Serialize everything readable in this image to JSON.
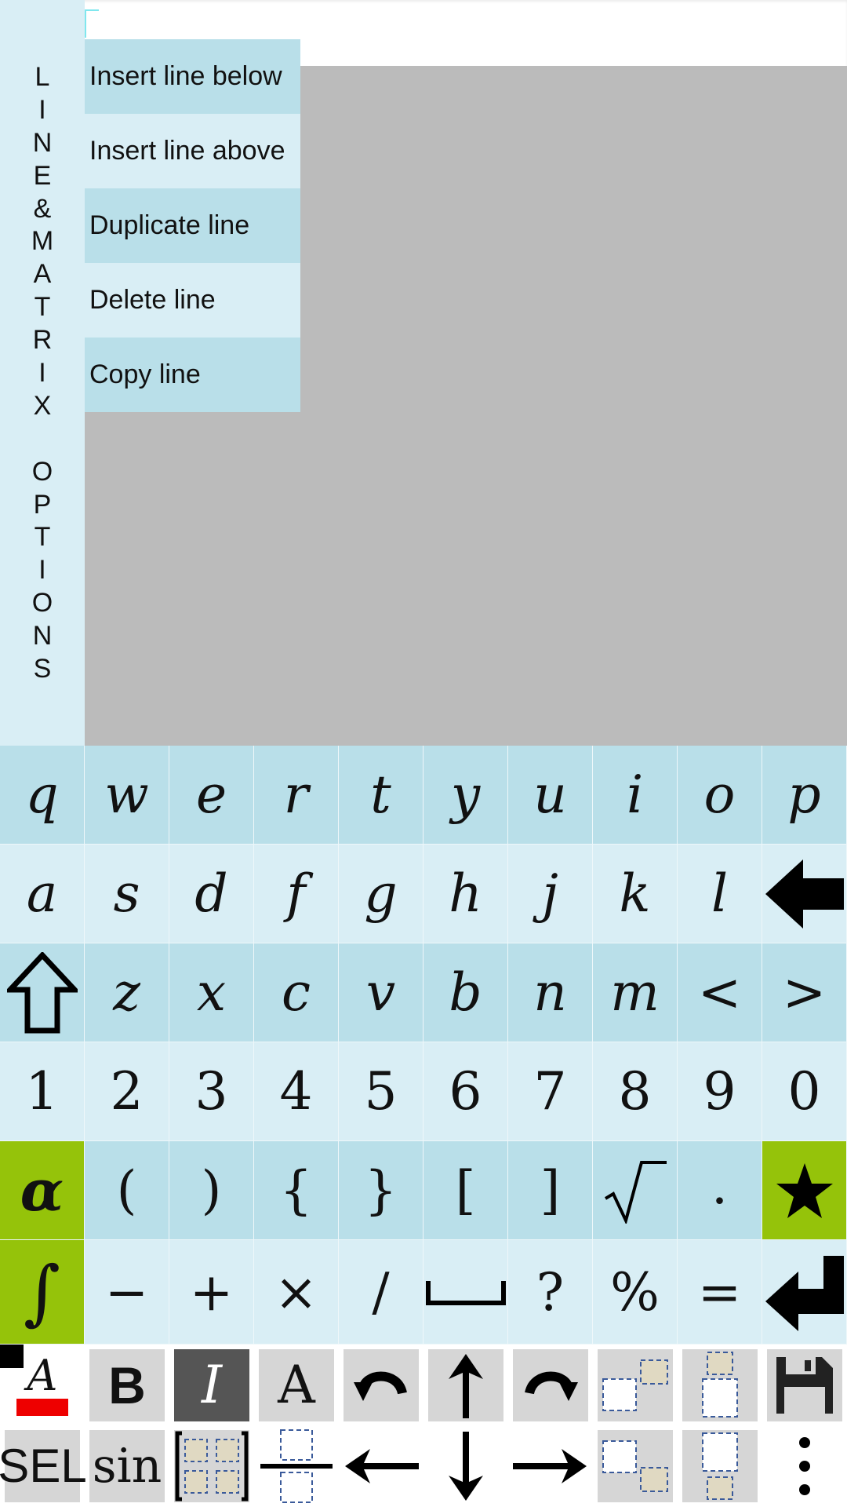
{
  "side_panel": {
    "title": "LINE&MATRIX OPTIONS"
  },
  "menu": {
    "items": [
      {
        "label": "Insert line below"
      },
      {
        "label": "Insert line above"
      },
      {
        "label": "Duplicate line"
      },
      {
        "label": "Delete line"
      },
      {
        "label": "Copy line"
      }
    ]
  },
  "keyboard": {
    "row1": [
      "q",
      "w",
      "e",
      "r",
      "t",
      "y",
      "u",
      "i",
      "o",
      "p"
    ],
    "row2": [
      "a",
      "s",
      "d",
      "f",
      "g",
      "h",
      "j",
      "k",
      "l"
    ],
    "row3": [
      "z",
      "x",
      "c",
      "v",
      "b",
      "n",
      "m",
      "<",
      ">"
    ],
    "row4": [
      "1",
      "2",
      "3",
      "4",
      "5",
      "6",
      "7",
      "8",
      "9",
      "0"
    ],
    "row5": {
      "alpha": "α",
      "keys": [
        "(",
        ")",
        "{",
        "}",
        "[",
        "]"
      ],
      "dot": "."
    },
    "row6": {
      "integral": "∫",
      "keys": [
        "−",
        "+",
        "×",
        "/"
      ],
      "question": "?",
      "percent": "%",
      "equals": "="
    }
  },
  "toolbar": {
    "bold": "B",
    "italic": "I",
    "font": "A",
    "color_letter": "A",
    "sel": "SEL",
    "sin": "sin"
  },
  "colors": {
    "key_dark": "#b9dfe9",
    "key_light": "#d9eef5",
    "accent_green": "#95c30a",
    "gray_area": "#bbbbbb",
    "text_color_swatch": "#ee0000"
  }
}
